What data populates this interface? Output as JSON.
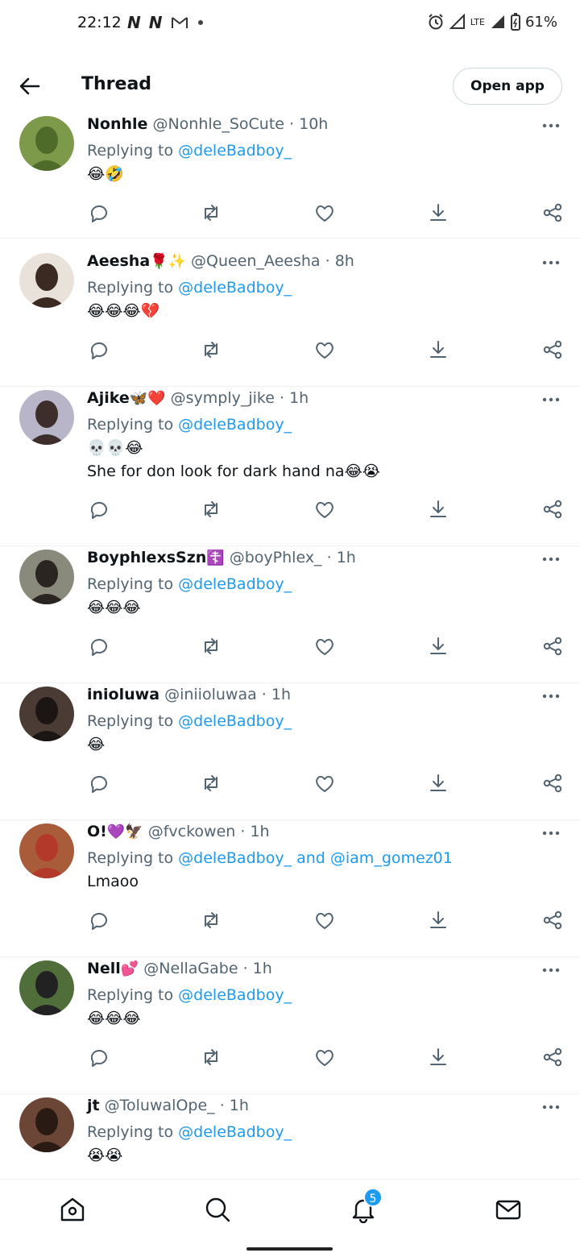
{
  "status_bar": {
    "time": "22:12",
    "notification_icons": [
      "N",
      "N"
    ],
    "mail_icon": "gmail-icon",
    "battery": "61%",
    "network": "LTE"
  },
  "header": {
    "title": "Thread",
    "open_app_label": "Open app"
  },
  "colors": {
    "accent": "#1d9bf0",
    "secondary_text": "#536471",
    "primary_text": "#0f1419"
  },
  "replying_label": "Replying to",
  "tweets": [
    {
      "name": "Nonhle",
      "name_emoji": "",
      "handle": "@Nonhle_SoCute",
      "time": "10h",
      "mentions": "@deleBadboy_",
      "body": "😂🤣",
      "body2": ""
    },
    {
      "name": "Aeesha",
      "name_emoji": "🌹✨",
      "handle": "@Queen_Aeesha",
      "time": "8h",
      "mentions": "@deleBadboy_",
      "body": "😂😂😂💔",
      "body2": ""
    },
    {
      "name": "Ajike",
      "name_emoji": "🦋❤️",
      "handle": "@symply_jike",
      "time": "1h",
      "mentions": "@deleBadboy_",
      "body": "💀💀😂",
      "body2": "She for don look for dark hand na😂😭"
    },
    {
      "name": "BoyphlexsSzn",
      "name_emoji": "☦️",
      "handle": "@boyPhlex_",
      "time": "1h",
      "mentions": "@deleBadboy_",
      "body": "😂😂😂",
      "body2": ""
    },
    {
      "name": "inioluwa",
      "name_emoji": "",
      "handle": "@iniioluwaa",
      "time": "1h",
      "mentions": "@deleBadboy_",
      "body": "😂",
      "body2": ""
    },
    {
      "name": "O!",
      "name_emoji": "💜🦅",
      "handle": "@fvckowen",
      "time": "1h",
      "mentions": "@deleBadboy_ and @iam_gomez01",
      "body": "Lmaoo",
      "body2": ""
    },
    {
      "name": "Nell",
      "name_emoji": "💕",
      "handle": "@NellaGabe",
      "time": "1h",
      "mentions": "@deleBadboy_",
      "body": "😂😂😂",
      "body2": ""
    },
    {
      "name": "jt",
      "name_emoji": "",
      "handle": "@ToluwalOpe_",
      "time": "1h",
      "mentions": "@deleBadboy_",
      "body": "😭😭",
      "body2": ""
    }
  ],
  "action_icons": [
    "reply-icon",
    "retweet-icon",
    "like-icon",
    "download-icon",
    "share-icon"
  ],
  "bottom_nav": {
    "items": [
      "home-icon",
      "search-icon",
      "notifications-icon",
      "messages-icon"
    ],
    "notification_count": "5"
  }
}
